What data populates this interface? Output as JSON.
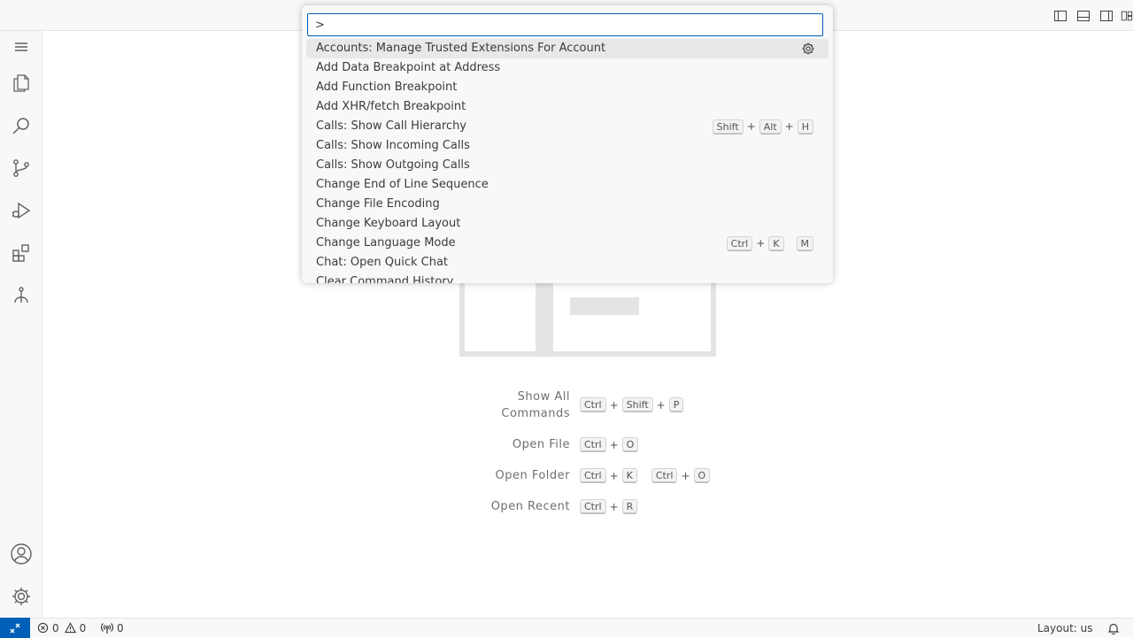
{
  "command_palette": {
    "input_value": ">",
    "items": [
      {
        "label": "Accounts: Manage Trusted Extensions For Account"
      },
      {
        "label": "Add Data Breakpoint at Address"
      },
      {
        "label": "Add Function Breakpoint"
      },
      {
        "label": "Add XHR/fetch Breakpoint"
      },
      {
        "label": "Calls: Show Call Hierarchy",
        "keys": [
          "Shift",
          "Alt",
          "H"
        ]
      },
      {
        "label": "Calls: Show Incoming Calls"
      },
      {
        "label": "Calls: Show Outgoing Calls"
      },
      {
        "label": "Change End of Line Sequence"
      },
      {
        "label": "Change File Encoding"
      },
      {
        "label": "Change Keyboard Layout"
      },
      {
        "label": "Change Language Mode",
        "keys": [
          "Ctrl",
          "K",
          "M"
        ]
      },
      {
        "label": "Chat: Open Quick Chat"
      },
      {
        "label": "Clear Command History"
      }
    ]
  },
  "shortcuts": {
    "show_all_commands": {
      "label": "Show All Commands",
      "keys": [
        "Ctrl",
        "Shift",
        "P"
      ]
    },
    "open_file": {
      "label": "Open File",
      "keys": [
        "Ctrl",
        "O"
      ]
    },
    "open_folder": {
      "label": "Open Folder",
      "keys": [
        "Ctrl",
        "K",
        "Ctrl",
        "O"
      ]
    },
    "open_recent": {
      "label": "Open Recent",
      "keys": [
        "Ctrl",
        "R"
      ]
    }
  },
  "activity_bar": {
    "items": [
      "menu-icon",
      "explorer-icon",
      "search-icon",
      "source-control-icon",
      "run-debug-icon",
      "extensions-icon",
      "remote-explorer-icon"
    ],
    "bottom": [
      "accounts-icon",
      "manage-gear-icon"
    ]
  },
  "statusbar": {
    "errors": "0",
    "warnings": "0",
    "ports": "0",
    "layout": "Layout: us"
  },
  "colors": {
    "accent": "#005fb8",
    "background": "#ffffff",
    "chrome": "#f8f8f8"
  }
}
